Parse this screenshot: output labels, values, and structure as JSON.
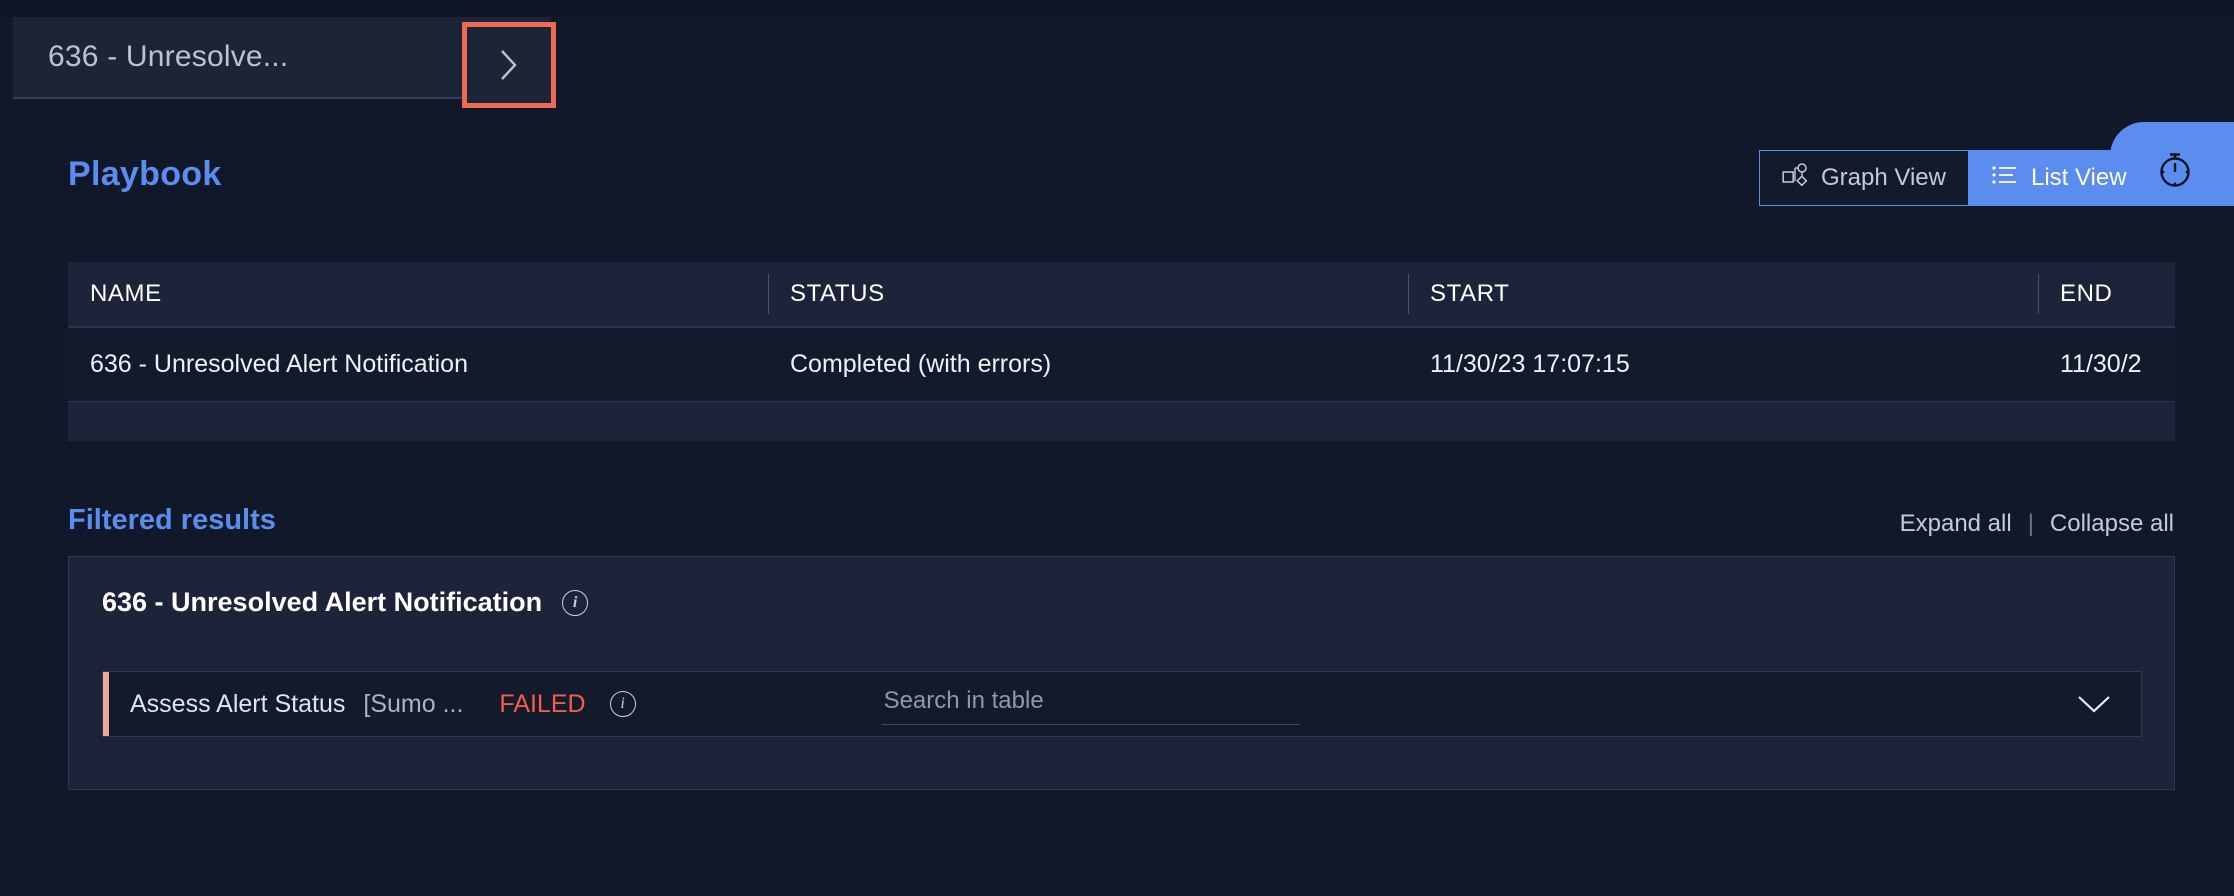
{
  "breadcrumb": {
    "label": "636 - Unresolve...",
    "next_icon": "chevron-right-icon"
  },
  "header": {
    "title": "Playbook",
    "view_toggle": {
      "graph_view_label": "Graph View",
      "list_view_label": "List View",
      "active": "List View",
      "graph_icon": "graph-nodes-icon",
      "list_icon": "list-icon"
    },
    "timer_icon": "stopwatch-icon",
    "accent_color": "#5b8def"
  },
  "table": {
    "columns": [
      "NAME",
      "STATUS",
      "START",
      "END"
    ],
    "rows": [
      {
        "name": "636 - Unresolved Alert Notification",
        "status": "Completed (with errors)",
        "status_color": "#55a44e",
        "start": "11/30/23 17:07:15",
        "end": "11/30/2"
      }
    ]
  },
  "filtered_results": {
    "title": "Filtered results",
    "expand_all_label": "Expand all",
    "separator": "|",
    "collapse_all_label": "Collapse all",
    "cards": [
      {
        "title": "636 - Unresolved Alert Notification",
        "info_icon": "info-icon",
        "action": {
          "name": "Assess Alert Status",
          "integration": "[Sumo ...",
          "status": "FAILED",
          "status_color": "#ef5f4b",
          "info_icon": "info-icon",
          "search_placeholder": "Search in table",
          "search_value": "",
          "expand_icon": "chevron-down-icon",
          "accent_bar_color": "#f0a79b"
        }
      }
    ]
  },
  "annotation": {
    "highlight_color": "#ef6a52"
  }
}
